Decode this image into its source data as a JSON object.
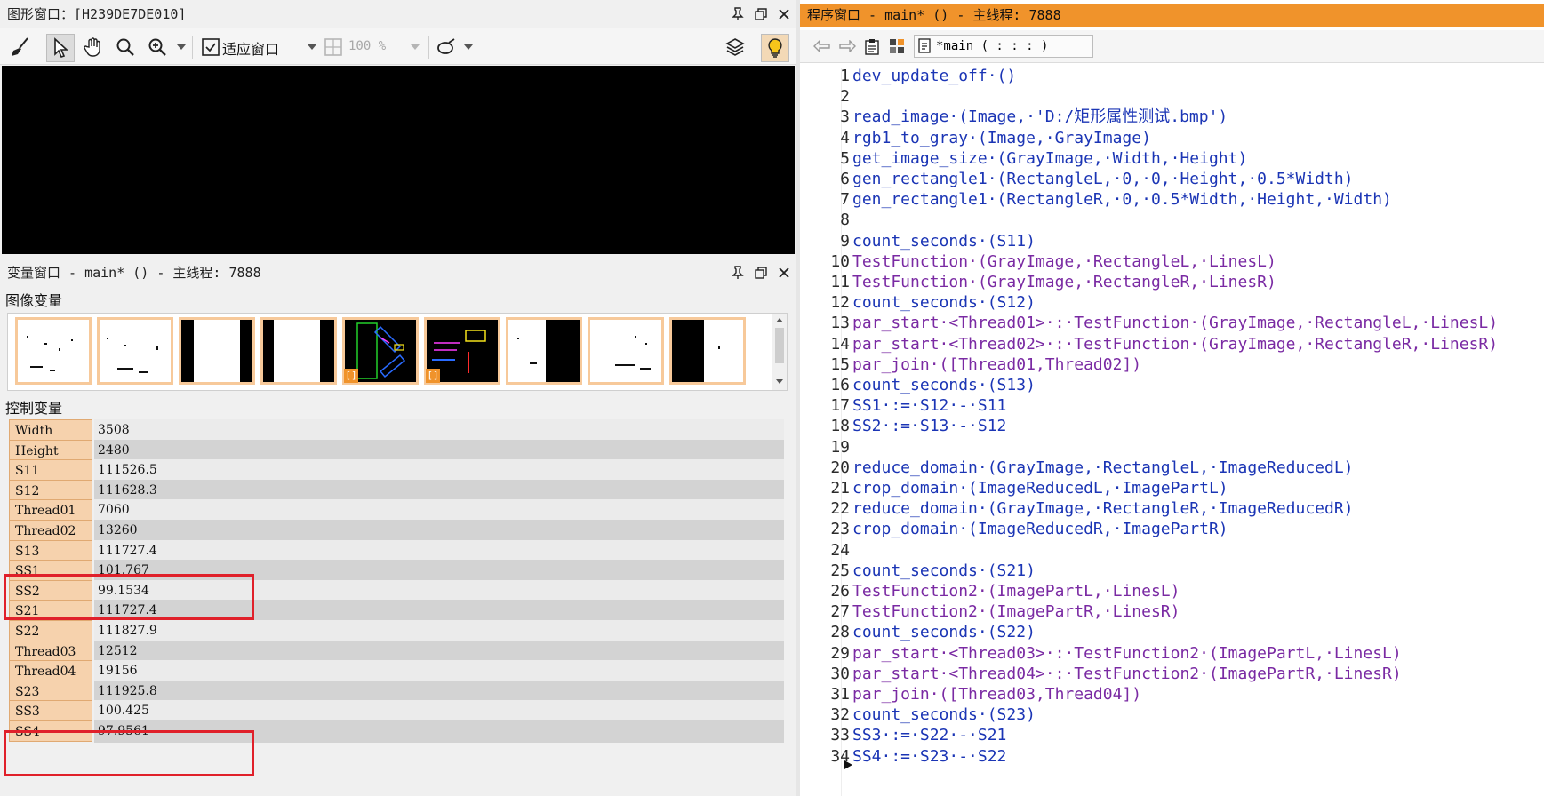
{
  "graphics_window": {
    "title": "图形窗口：[H239DE7DE010]",
    "toolbar": {
      "fit_window_label": "适应窗口",
      "zoom_value": "100 %"
    }
  },
  "variable_window": {
    "title": "变量窗口 - main* () - 主线程: 7888",
    "image_vars_label": "图像变量",
    "control_vars_label": "控制变量",
    "thumb_badge": "[]",
    "control_vars": [
      {
        "name": "Width",
        "value": "3508"
      },
      {
        "name": "Height",
        "value": "2480"
      },
      {
        "name": "S11",
        "value": "111526.5"
      },
      {
        "name": "S12",
        "value": "111628.3"
      },
      {
        "name": "Thread01",
        "value": "7060"
      },
      {
        "name": "Thread02",
        "value": "13260"
      },
      {
        "name": "S13",
        "value": "111727.4"
      },
      {
        "name": "SS1",
        "value": "101.767"
      },
      {
        "name": "SS2",
        "value": "99.1534"
      },
      {
        "name": "S21",
        "value": "111727.4"
      },
      {
        "name": "S22",
        "value": "111827.9"
      },
      {
        "name": "Thread03",
        "value": "12512"
      },
      {
        "name": "Thread04",
        "value": "19156"
      },
      {
        "name": "S23",
        "value": "111925.8"
      },
      {
        "name": "SS3",
        "value": "100.425"
      },
      {
        "name": "SS4",
        "value": "97.9561"
      }
    ],
    "highlight_color": "#e0202a"
  },
  "program_window": {
    "title": "程序窗口 - main* () - 主线程: 7888",
    "accent_color": "#f0932b",
    "procedure_selector": "*main ( : : : )",
    "lines": [
      {
        "n": "1",
        "text": "dev_update_off·()",
        "kind": "op"
      },
      {
        "n": "2",
        "text": "",
        "kind": "op"
      },
      {
        "n": "3",
        "text": "read_image·(Image,·'D:/矩形属性测试.bmp')",
        "kind": "op"
      },
      {
        "n": "4",
        "text": "rgb1_to_gray·(Image,·GrayImage)",
        "kind": "op"
      },
      {
        "n": "5",
        "text": "get_image_size·(GrayImage,·Width,·Height)",
        "kind": "op"
      },
      {
        "n": "6",
        "text": "gen_rectangle1·(RectangleL,·0,·0,·Height,·0.5*Width)",
        "kind": "op"
      },
      {
        "n": "7",
        "text": "gen_rectangle1·(RectangleR,·0,·0.5*Width,·Height,·Width)",
        "kind": "op"
      },
      {
        "n": "8",
        "text": "",
        "kind": "op"
      },
      {
        "n": "9",
        "text": "count_seconds·(S11)",
        "kind": "op"
      },
      {
        "n": "10",
        "text": "TestFunction·(GrayImage,·RectangleL,·LinesL)",
        "kind": "fn"
      },
      {
        "n": "11",
        "text": "TestFunction·(GrayImage,·RectangleR,·LinesR)",
        "kind": "fn"
      },
      {
        "n": "12",
        "text": "count_seconds·(S12)",
        "kind": "op"
      },
      {
        "n": "13",
        "text": "par_start·<Thread01>·:·TestFunction·(GrayImage,·RectangleL,·LinesL)",
        "kind": "fn"
      },
      {
        "n": "14",
        "text": "par_start·<Thread02>·:·TestFunction·(GrayImage,·RectangleR,·LinesR)",
        "kind": "fn"
      },
      {
        "n": "15",
        "text": "par_join·([Thread01,Thread02])",
        "kind": "fn"
      },
      {
        "n": "16",
        "text": "count_seconds·(S13)",
        "kind": "op"
      },
      {
        "n": "17",
        "text": "SS1·:=·S12·-·S11",
        "kind": "as"
      },
      {
        "n": "18",
        "text": "SS2·:=·S13·-·S12",
        "kind": "as"
      },
      {
        "n": "19",
        "text": "",
        "kind": "op"
      },
      {
        "n": "20",
        "text": "reduce_domain·(GrayImage,·RectangleL,·ImageReducedL)",
        "kind": "op"
      },
      {
        "n": "21",
        "text": "crop_domain·(ImageReducedL,·ImagePartL)",
        "kind": "op"
      },
      {
        "n": "22",
        "text": "reduce_domain·(GrayImage,·RectangleR,·ImageReducedR)",
        "kind": "op"
      },
      {
        "n": "23",
        "text": "crop_domain·(ImageReducedR,·ImagePartR)",
        "kind": "op"
      },
      {
        "n": "24",
        "text": "",
        "kind": "op"
      },
      {
        "n": "25",
        "text": "count_seconds·(S21)",
        "kind": "op"
      },
      {
        "n": "26",
        "text": "TestFunction2·(ImagePartL,·LinesL)",
        "kind": "fn"
      },
      {
        "n": "27",
        "text": "TestFunction2·(ImagePartR,·LinesR)",
        "kind": "fn"
      },
      {
        "n": "28",
        "text": "count_seconds·(S22)",
        "kind": "op"
      },
      {
        "n": "29",
        "text": "par_start·<Thread03>·:·TestFunction2·(ImagePartL,·LinesL)",
        "kind": "fn"
      },
      {
        "n": "30",
        "text": "par_start·<Thread04>·:·TestFunction2·(ImagePartR,·LinesR)",
        "kind": "fn"
      },
      {
        "n": "31",
        "text": "par_join·([Thread03,Thread04])",
        "kind": "fn"
      },
      {
        "n": "32",
        "text": "count_seconds·(S23)",
        "kind": "op"
      },
      {
        "n": "33",
        "text": "SS3·:=·S22·-·S21",
        "kind": "as"
      },
      {
        "n": "34",
        "text": "SS4·:=·S23·-·S22",
        "kind": "as"
      }
    ]
  }
}
